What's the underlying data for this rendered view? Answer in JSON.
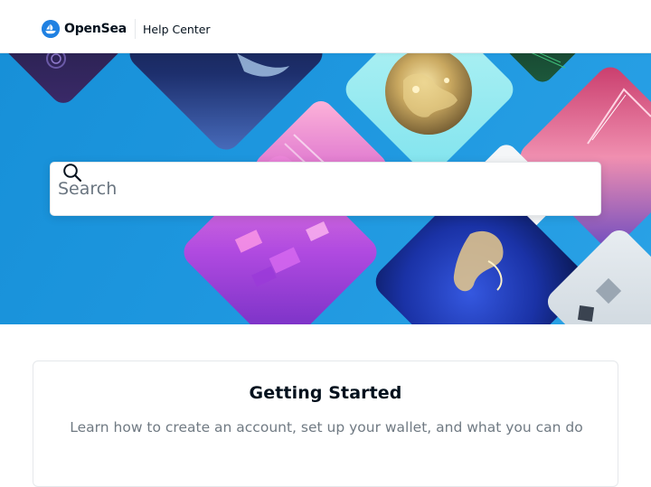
{
  "header": {
    "brand_name": "OpenSea",
    "brand_sub": "Help Center"
  },
  "search": {
    "placeholder": "Search"
  },
  "sections": [
    {
      "title": "Getting Started",
      "description": "Learn how to create an account, set up your wallet, and what you can do"
    }
  ]
}
